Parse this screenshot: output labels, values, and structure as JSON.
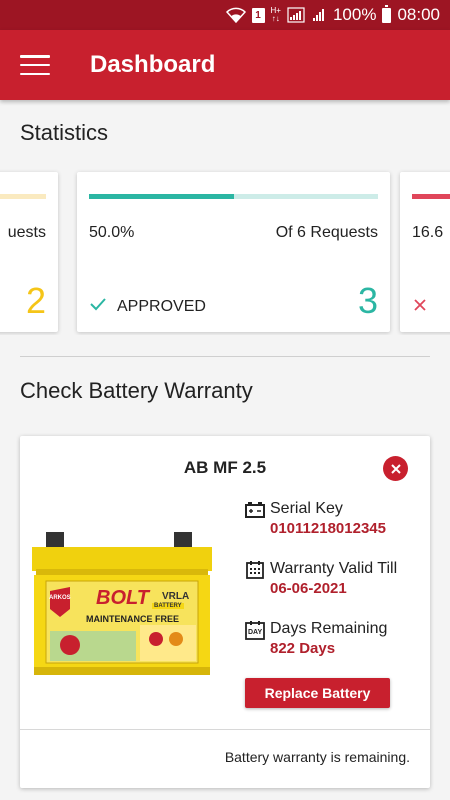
{
  "status_bar": {
    "battery": "100%",
    "time": "08:00",
    "sim": "1",
    "network": "H+"
  },
  "app_bar": {
    "title": "Dashboard"
  },
  "statistics": {
    "title": "Statistics",
    "cards": [
      {
        "percent": "",
        "of_text": "uests",
        "status": "",
        "count": "2",
        "color": "#f5c518",
        "track": "#faeac0",
        "fill": 0.33
      },
      {
        "percent": "50.0%",
        "of_text": "Of 6 Requests",
        "status": "APPROVED",
        "count": "3",
        "color": "#2bb6a3",
        "track": "#cdece8",
        "fill": 0.5
      },
      {
        "percent": "16.6",
        "of_text": "",
        "status": "",
        "count": "",
        "color": "#e0465a",
        "track": "#f5c9cf",
        "fill": 0.17
      }
    ]
  },
  "warranty": {
    "title": "Check Battery Warranty",
    "product_name": "AB MF 2.5",
    "serial_label": "Serial Key",
    "serial_value": "01011218012345",
    "valid_label": "Warranty Valid Till",
    "valid_value": "06-06-2021",
    "days_label": "Days Remaining",
    "days_value": "822 Days",
    "replace_label": "Replace Battery",
    "footer": "Battery warranty is remaining.",
    "battery_brand": "BOLT",
    "battery_sub": "MAINTENANCE FREE",
    "battery_tag": "VRLA",
    "battery_maker": "ARKOS",
    "battery_word": "BATTERY",
    "day_icon_text": "DAY",
    "accent": "#c8202e"
  }
}
